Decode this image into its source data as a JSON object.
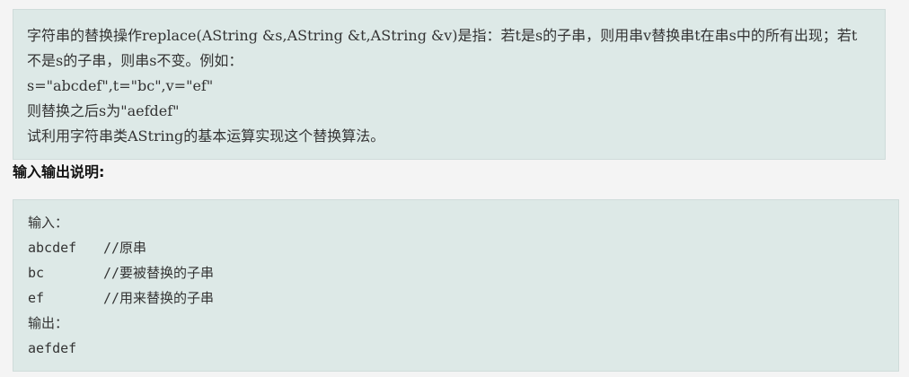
{
  "problem": {
    "description": "字符串的替换操作replace(AString &s,AString &t,AString &v)是指：若t是s的子串，则用串v替换串t在串s中的所有出现；若t不是s的子串，则串s不变。例如：",
    "example_line": "s=\"abcdef\",t=\"bc\",v=\"ef\"",
    "result_line": "则替换之后s为\"aefdef\"",
    "task_line": "试利用字符串类AString的基本运算实现这个替换算法。"
  },
  "io_section": {
    "heading": "输入输出说明:",
    "lines": [
      {
        "value": "输入：",
        "comment": ""
      },
      {
        "value": "abcdef",
        "comment": "//原串"
      },
      {
        "value": "bc",
        "comment": "//要被替换的子串"
      },
      {
        "value": "ef",
        "comment": "//用来替换的子串"
      },
      {
        "value": "输出：",
        "comment": ""
      },
      {
        "value": "aefdef",
        "comment": ""
      }
    ]
  }
}
